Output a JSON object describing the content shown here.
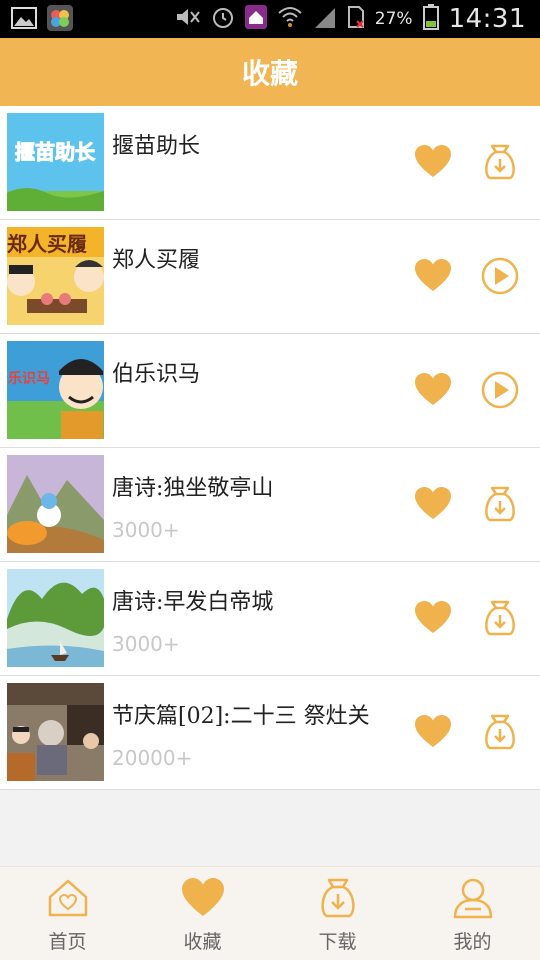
{
  "status_bar": {
    "battery_percent": "27%",
    "time": "14:31",
    "icons": [
      "gallery-icon",
      "photo-app-icon",
      "mute-icon",
      "alarm-icon",
      "home-app-icon",
      "wifi-icon",
      "signal-icon",
      "sim-icon",
      "battery-icon"
    ]
  },
  "header": {
    "title": "收藏"
  },
  "colors": {
    "accent": "#f1b553",
    "icon": "#f0b24d",
    "separator": "#dedede"
  },
  "items": [
    {
      "title": "揠苗助长",
      "count": "",
      "action_icon": "download-icon",
      "thumb_text": "揠苗助长"
    },
    {
      "title": "郑人买履",
      "count": "",
      "action_icon": "play-icon",
      "thumb_text": "郑人买履"
    },
    {
      "title": "伯乐识马",
      "count": "",
      "action_icon": "play-icon",
      "thumb_text": "乐识马"
    },
    {
      "title": "唐诗:独坐敬亭山",
      "count": "3000+",
      "action_icon": "download-icon",
      "thumb_text": ""
    },
    {
      "title": "唐诗:早发白帝城",
      "count": "3000+",
      "action_icon": "download-icon",
      "thumb_text": ""
    },
    {
      "title": "节庆篇[02]:二十三 祭灶关",
      "count": "20000+",
      "action_icon": "download-icon",
      "thumb_text": ""
    }
  ],
  "nav": [
    {
      "label": "首页",
      "icon": "home-icon",
      "active": false
    },
    {
      "label": "收藏",
      "icon": "heart-icon",
      "active": true
    },
    {
      "label": "下载",
      "icon": "download-icon",
      "active": false
    },
    {
      "label": "我的",
      "icon": "user-icon",
      "active": false
    }
  ]
}
